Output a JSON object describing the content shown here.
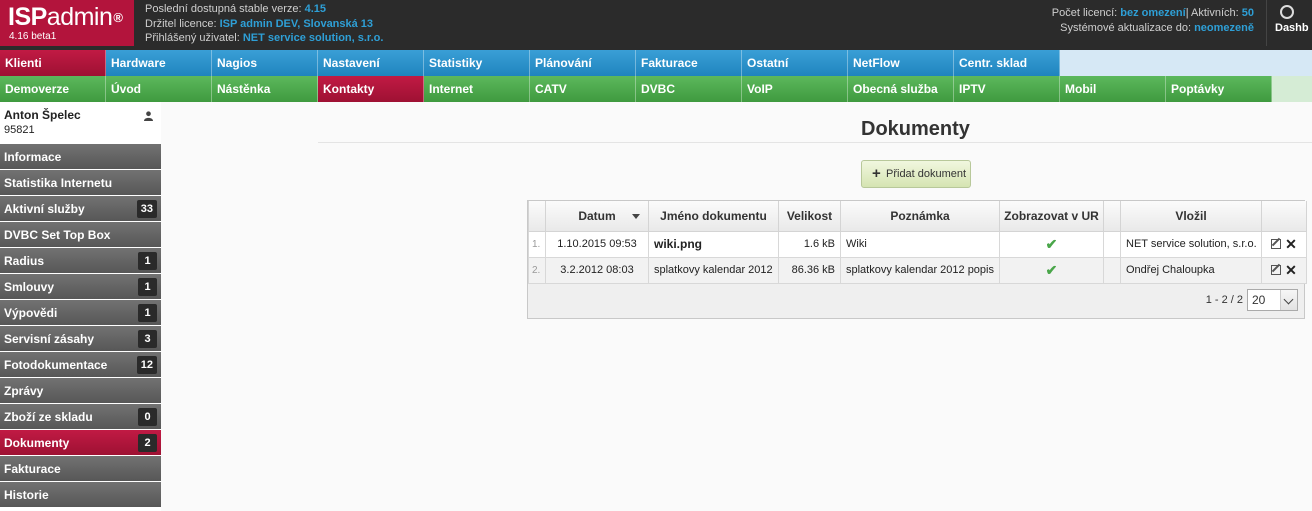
{
  "header": {
    "brand_bold": "ISP",
    "brand_thin": "admin",
    "brand_mark": "®",
    "version": "4.16 beta1",
    "info": [
      {
        "label": "Poslední dostupná stable verze: ",
        "value": "4.15"
      },
      {
        "label": "Držitel licence: ",
        "value": "ISP admin DEV, Slovanská 13"
      },
      {
        "label": "Přihlášený uživatel: ",
        "value": "NET service solution, s.r.o."
      }
    ],
    "licence_label": "Počet licencí: ",
    "licence_value": "bez omezení",
    "active_label": "| Aktivních: ",
    "active_value": "50",
    "updates_label": "Systémové aktualizace do: ",
    "updates_value": "neomezeně",
    "dashboard_label": "Dashb"
  },
  "menu_row1": [
    "Klienti",
    "Hardware",
    "Nagios",
    "Nastavení",
    "Statistiky",
    "Plánování",
    "Fakturace",
    "Ostatní",
    "NetFlow",
    "Centr. sklad"
  ],
  "menu_row2": [
    "Demoverze",
    "Úvod",
    "Nástěnka",
    "Kontakty",
    "Internet",
    "CATV",
    "DVBC",
    "VoIP",
    "Obecná služba",
    "IPTV",
    "Mobil",
    "Poptávky"
  ],
  "sidebar": {
    "user_name": "Anton Špelec",
    "user_id": "95821",
    "items": [
      {
        "label": "Informace",
        "badge": ""
      },
      {
        "label": "Statistika Internetu",
        "badge": ""
      },
      {
        "label": "Aktivní služby",
        "badge": "33"
      },
      {
        "label": "DVBC Set Top Box",
        "badge": ""
      },
      {
        "label": "Radius",
        "badge": "1"
      },
      {
        "label": "Smlouvy",
        "badge": "1"
      },
      {
        "label": "Výpovědi",
        "badge": "1"
      },
      {
        "label": "Servisní zásahy",
        "badge": "3"
      },
      {
        "label": "Fotodokumentace",
        "badge": "12"
      },
      {
        "label": "Zprávy",
        "badge": ""
      },
      {
        "label": "Zboží ze skladu",
        "badge": "0"
      },
      {
        "label": "Dokumenty",
        "badge": "2"
      },
      {
        "label": "Fakturace",
        "badge": ""
      },
      {
        "label": "Historie",
        "badge": ""
      }
    ]
  },
  "main": {
    "title": "Dokumenty",
    "add_button": "Přidat dokument",
    "columns": [
      "",
      "Datum",
      "Jméno dokumentu",
      "Velikost",
      "Poznámka",
      "Zobrazovat v UR",
      "",
      "Vložil",
      ""
    ],
    "rows": [
      {
        "num": "1.",
        "date": "1.10.2015 09:53",
        "name": "wiki.png",
        "size": "1.6 kB",
        "note": "Wiki",
        "by": "NET service solution, s.r.o."
      },
      {
        "num": "2.",
        "date": "3.2.2012 08:03",
        "name": "splatkovy kalendar 2012",
        "size": "86.36 kB",
        "note": "splatkovy kalendar 2012 popis",
        "by": "Ondřej Chaloupka"
      }
    ],
    "pager_text": "1 - 2 / 2",
    "page_size": "20"
  },
  "colors": {
    "brand": "#b3143c",
    "blue_menu": "#2a91c9",
    "green_menu": "#4aa84a",
    "active": "#b3143c",
    "sidebar": "#646464"
  }
}
